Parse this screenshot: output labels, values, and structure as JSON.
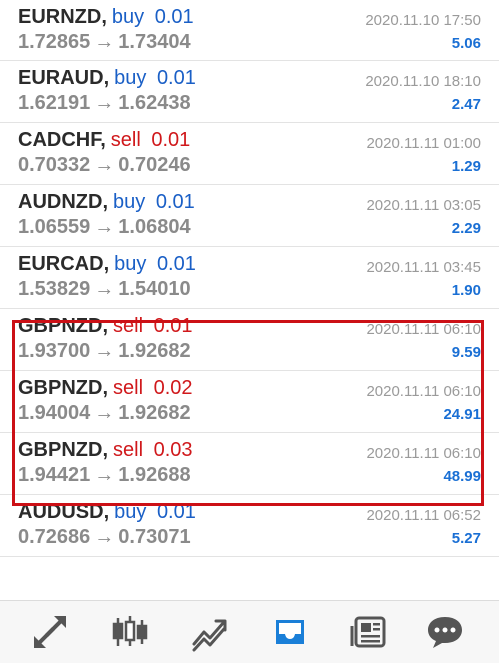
{
  "orders": [
    {
      "symbol": "EURNZD",
      "type": "buy",
      "lots": "0.01",
      "open_price": "1.72865",
      "close_price": "1.73404",
      "time": "2020.11.10 17:50",
      "profit": "5.06"
    },
    {
      "symbol": "EURAUD",
      "type": "buy",
      "lots": "0.01",
      "open_price": "1.62191",
      "close_price": "1.62438",
      "time": "2020.11.10 18:10",
      "profit": "2.47"
    },
    {
      "symbol": "CADCHF",
      "type": "sell",
      "lots": "0.01",
      "open_price": "0.70332",
      "close_price": "0.70246",
      "time": "2020.11.11 01:00",
      "profit": "1.29"
    },
    {
      "symbol": "AUDNZD",
      "type": "buy",
      "lots": "0.01",
      "open_price": "1.06559",
      "close_price": "1.06804",
      "time": "2020.11.11 03:05",
      "profit": "2.29"
    },
    {
      "symbol": "EURCAD",
      "type": "buy",
      "lots": "0.01",
      "open_price": "1.53829",
      "close_price": "1.54010",
      "time": "2020.11.11 03:45",
      "profit": "1.90"
    },
    {
      "symbol": "GBPNZD",
      "type": "sell",
      "lots": "0.01",
      "open_price": "1.93700",
      "close_price": "1.92682",
      "time": "2020.11.11 06:10",
      "profit": "9.59"
    },
    {
      "symbol": "GBPNZD",
      "type": "sell",
      "lots": "0.02",
      "open_price": "1.94004",
      "close_price": "1.92682",
      "time": "2020.11.11 06:10",
      "profit": "24.91"
    },
    {
      "symbol": "GBPNZD",
      "type": "sell",
      "lots": "0.03",
      "open_price": "1.94421",
      "close_price": "1.92688",
      "time": "2020.11.11 06:10",
      "profit": "48.99"
    },
    {
      "symbol": "AUDUSD",
      "type": "buy",
      "lots": "0.01",
      "open_price": "0.72686",
      "close_price": "0.73071",
      "time": "2020.11.11 06:52",
      "profit": "5.27"
    }
  ],
  "arrow_glyph": "→",
  "colors": {
    "buy": "#1a5fc6",
    "sell": "#d0181b",
    "profit": "#1a6fd4",
    "highlight": "#cc1016",
    "nav_icon": "#555555",
    "nav_active": "#1a7fd8"
  },
  "bottom_nav": [
    {
      "icon": "quotes-icon",
      "active": false
    },
    {
      "icon": "chart-icon",
      "active": false
    },
    {
      "icon": "trade-icon",
      "active": false
    },
    {
      "icon": "history-icon",
      "active": true
    },
    {
      "icon": "news-icon",
      "active": false
    },
    {
      "icon": "messages-icon",
      "active": false
    }
  ]
}
